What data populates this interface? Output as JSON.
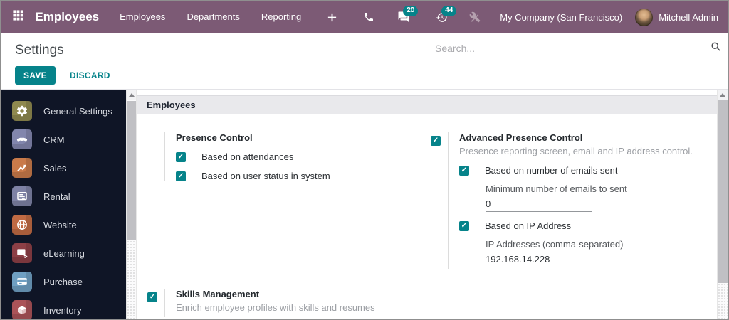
{
  "colors": {
    "accent": "#06838a",
    "navbar_bg": "#7c5a75",
    "sidebar_bg": "#0f1526",
    "section_header_bg": "#e9e9ec"
  },
  "navbar": {
    "app_name": "Employees",
    "menu": [
      "Employees",
      "Departments",
      "Reporting"
    ],
    "plus_icon": "plus",
    "icons": [
      "apps-grid",
      "phone",
      "chat-bubbles",
      "history-clock",
      "crossed-tools"
    ],
    "messages_badge": "20",
    "activities_badge": "44",
    "company": "My Company (San Francisco)",
    "user_name": "Mitchell Admin"
  },
  "control_panel": {
    "title": "Settings",
    "save_label": "SAVE",
    "discard_label": "DISCARD",
    "search_placeholder": "Search...",
    "search_icon": "magnifier"
  },
  "sidebar": {
    "items": [
      {
        "label": "General Settings",
        "icon": "gear",
        "color": "#8f894f"
      },
      {
        "label": "CRM",
        "icon": "handshake",
        "color": "#8286ad"
      },
      {
        "label": "Sales",
        "icon": "chart-up",
        "color": "#c97a4a"
      },
      {
        "label": "Rental",
        "icon": "board",
        "color": "#7e82a5"
      },
      {
        "label": "Website",
        "icon": "globe",
        "color": "#c06a44"
      },
      {
        "label": "eLearning",
        "icon": "presentation",
        "color": "#8d3f46"
      },
      {
        "label": "Purchase",
        "icon": "credit-card",
        "color": "#6f9fc2"
      },
      {
        "label": "Inventory",
        "icon": "package-box",
        "color": "#aa5358"
      }
    ]
  },
  "content": {
    "section_title": "Employees",
    "presence": {
      "title": "Presence Control",
      "options": [
        "Based on attendances",
        "Based on user status in system"
      ]
    },
    "advanced": {
      "enabled": true,
      "title": "Advanced Presence Control",
      "description": "Presence reporting screen, email and IP address control.",
      "email_option": "Based on number of emails sent",
      "email_field_label": "Minimum number of emails to sent",
      "email_field_value": "0",
      "ip_option": "Based on IP Address",
      "ip_field_label": "IP Addresses (comma-separated)",
      "ip_field_value": "192.168.14.228"
    },
    "skills": {
      "enabled": true,
      "title": "Skills Management",
      "description": "Enrich employee profiles with skills and resumes"
    }
  }
}
